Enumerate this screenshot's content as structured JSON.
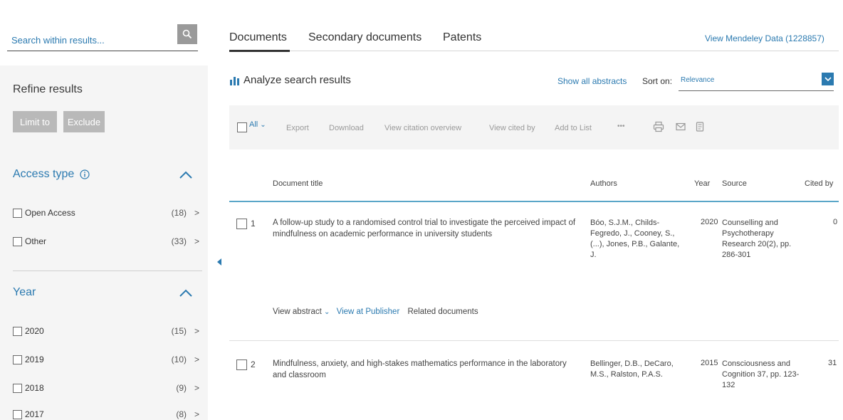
{
  "sidebar": {
    "search": {
      "placeholder": "Search within results...",
      "icon": "search-icon"
    },
    "refine_title": "Refine results",
    "limit_to": "Limit to",
    "exclude": "Exclude",
    "access_type": {
      "label": "Access type",
      "items": [
        {
          "label": "Open Access",
          "count": "(18)"
        },
        {
          "label": "Other",
          "count": "(33)"
        }
      ]
    },
    "year": {
      "label": "Year",
      "items": [
        {
          "label": "2020",
          "count": "(15)"
        },
        {
          "label": "2019",
          "count": "(10)"
        },
        {
          "label": "2018",
          "count": "(9)"
        },
        {
          "label": "2017",
          "count": "(8)"
        }
      ]
    }
  },
  "tabs": {
    "documents": "Documents",
    "secondary": "Secondary documents",
    "patents": "Patents",
    "mendeley": "View Mendeley Data (1228857)"
  },
  "results_bar": {
    "analyze": "Analyze search results",
    "show_all_abstracts": "Show all abstracts",
    "sort_label": "Sort on:",
    "sort_value": "Relevance"
  },
  "toolbar": {
    "all": "All",
    "export": "Export",
    "download": "Download",
    "view_citation_overview": "View citation overview",
    "view_cited_by": "View cited by",
    "add_to_list": "Add to List",
    "more": "•••"
  },
  "table": {
    "headers": {
      "title": "Document title",
      "authors": "Authors",
      "year": "Year",
      "source": "Source",
      "cited_by": "Cited by"
    },
    "rows": [
      {
        "num": "1",
        "title": "A follow-up study to a randomised control trial to investigate the perceived impact of mindfulness on academic performance in university students",
        "authors": "Bóo, S.J.M., Childs-Fegredo, J., Cooney, S., (...), Jones, P.B., Galante, J.",
        "year": "2020",
        "source": "Counselling and Psychotherapy Research 20(2), pp. 286-301",
        "cited": "0"
      },
      {
        "num": "2",
        "title": "Mindfulness, anxiety, and high-stakes mathematics performance in the laboratory and classroom",
        "authors": "Bellinger, D.B., DeCaro, M.S., Ralston, P.A.S.",
        "year": "2015",
        "source": "Consciousness and Cognition 37, pp. 123-132",
        "cited": "31"
      }
    ],
    "row_links": {
      "view_abstract": "View abstract",
      "view_at_publisher": "View at Publisher",
      "related_documents": "Related documents"
    }
  },
  "colors": {
    "accent": "#2b7ab0",
    "rule": "#5aa6c8"
  }
}
